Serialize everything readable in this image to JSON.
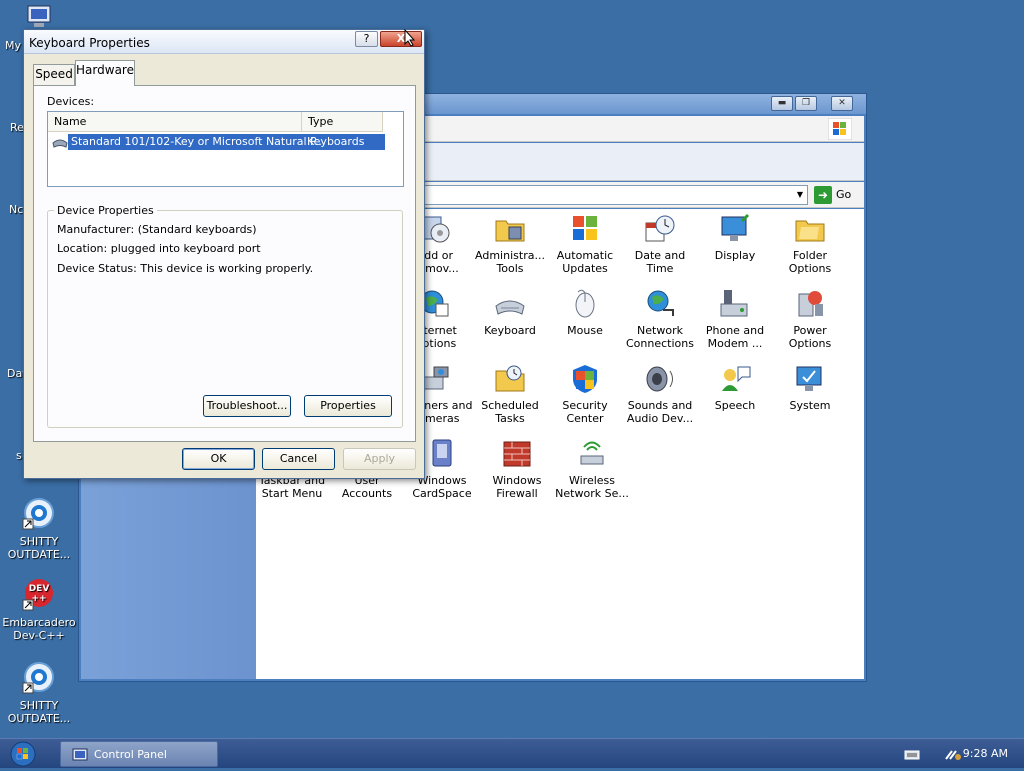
{
  "desktop": {
    "icons": [
      {
        "label_line1": "SHITTY",
        "label_line2": "OUTDATE..."
      },
      {
        "label_line1": "Embarcadero",
        "label_line2": "Dev-C++"
      },
      {
        "label_line1": "SHITTY",
        "label_line2": "OUTDATE..."
      }
    ],
    "partial_labels": [
      "My",
      "Re",
      "Nc",
      "Dat",
      "s"
    ],
    "devcpp_badge": "DEV\n++"
  },
  "control_panel": {
    "go_label": "Go",
    "items": [
      {
        "line1": "Add or",
        "line2": "Remov...",
        "icon": "add-remove-programs-icon"
      },
      {
        "line1": "Administra...",
        "line2": "Tools",
        "icon": "administrative-tools-icon"
      },
      {
        "line1": "Automatic",
        "line2": "Updates",
        "icon": "automatic-updates-icon"
      },
      {
        "line1": "Date and",
        "line2": "Time",
        "icon": "date-time-icon"
      },
      {
        "line1": "Display",
        "line2": "",
        "icon": "display-icon"
      },
      {
        "line1": "Folder",
        "line2": "Options",
        "icon": "folder-options-icon"
      },
      {
        "line1": "Internet",
        "line2": "Options",
        "icon": "internet-options-icon"
      },
      {
        "line1": "Keyboard",
        "line2": "",
        "icon": "keyboard-icon"
      },
      {
        "line1": "Mouse",
        "line2": "",
        "icon": "mouse-icon"
      },
      {
        "line1": "Network",
        "line2": "Connections",
        "icon": "network-connections-icon"
      },
      {
        "line1": "Phone and",
        "line2": "Modem ...",
        "icon": "phone-modem-icon"
      },
      {
        "line1": "Power",
        "line2": "Options",
        "icon": "power-options-icon"
      },
      {
        "line1": "Scanners and",
        "line2": "Cameras",
        "icon": "scanners-cameras-icon"
      },
      {
        "line1": "Scheduled",
        "line2": "Tasks",
        "icon": "scheduled-tasks-icon"
      },
      {
        "line1": "Security",
        "line2": "Center",
        "icon": "security-center-icon"
      },
      {
        "line1": "Sounds and",
        "line2": "Audio Dev...",
        "icon": "sounds-audio-icon"
      },
      {
        "line1": "Speech",
        "line2": "",
        "icon": "speech-icon"
      },
      {
        "line1": "System",
        "line2": "",
        "icon": "system-icon"
      },
      {
        "line1": "Taskbar and",
        "line2": "Start Menu",
        "icon": "taskbar-start-menu-icon"
      },
      {
        "line1": "User",
        "line2": "Accounts",
        "icon": "user-accounts-icon"
      },
      {
        "line1": "Windows",
        "line2": "CardSpace",
        "icon": "windows-cardspace-icon"
      },
      {
        "line1": "Windows",
        "line2": "Firewall",
        "icon": "windows-firewall-icon"
      },
      {
        "line1": "Wireless",
        "line2": "Network Se...",
        "icon": "wireless-network-icon"
      }
    ]
  },
  "dialog": {
    "title": "Keyboard Properties",
    "help_button": "?",
    "close_button": "X",
    "tabs": [
      "Speed",
      "Hardware"
    ],
    "active_tab": "Hardware",
    "devices_label": "Devices:",
    "columns": [
      "Name",
      "Type"
    ],
    "device": {
      "name": "Standard 101/102-Key or Microsoft Natural P...",
      "type": "Keyboards"
    },
    "device_properties": {
      "legend": "Device Properties",
      "manufacturer": "Manufacturer: (Standard keyboards)",
      "location": "Location: plugged into keyboard port",
      "status": "Device Status: This device is working properly."
    },
    "troubleshoot_button": "Troubleshoot...",
    "properties_button": "Properties",
    "ok_button": "OK",
    "cancel_button": "Cancel",
    "apply_button": "Apply"
  },
  "taskbar": {
    "task_label": "Control Panel",
    "clock": "9:28 AM"
  },
  "colors": {
    "desktop": "#3a6ea5",
    "selection": "#316ac5",
    "dialog_face": "#ece9d8"
  }
}
